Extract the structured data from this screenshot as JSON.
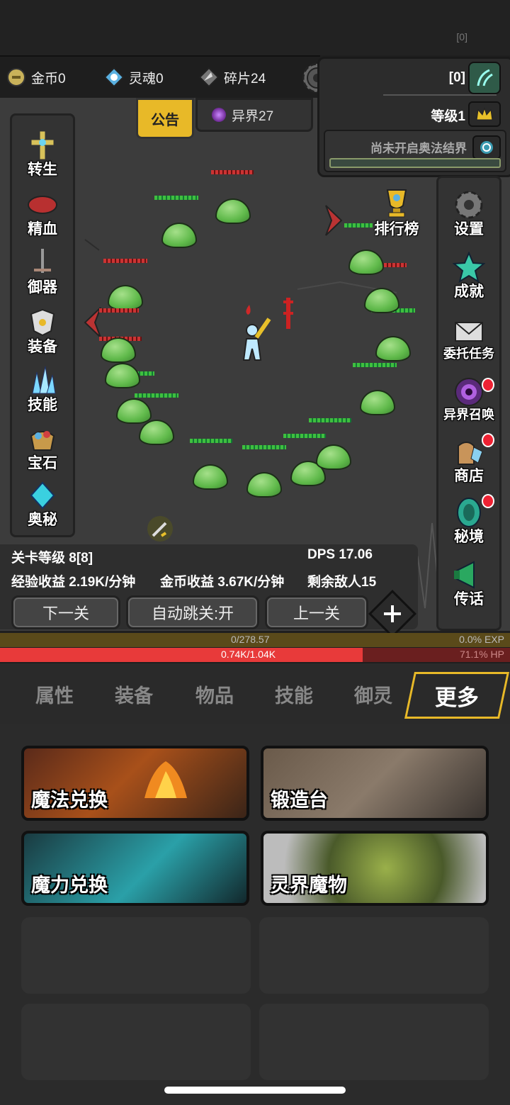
{
  "status": {
    "corner": "[0]"
  },
  "currency": {
    "gold": "金币0",
    "soul": "灵魂0",
    "shard": "碎片24"
  },
  "tabs_top": {
    "notice": "公告",
    "otherworld": "异界27"
  },
  "player_panel": {
    "bracket": "[0]",
    "level": "等级1",
    "barrier": "尚未开启奥法结界"
  },
  "left_menu": [
    {
      "label": "转生",
      "icon": "cross-icon"
    },
    {
      "label": "精血",
      "icon": "blood-gem-icon"
    },
    {
      "label": "御器",
      "icon": "sword-icon"
    },
    {
      "label": "装备",
      "icon": "armor-icon"
    },
    {
      "label": "技能",
      "icon": "ice-crystal-icon"
    },
    {
      "label": "宝石",
      "icon": "gem-bag-icon"
    },
    {
      "label": "奥秘",
      "icon": "arcane-crystal-icon"
    }
  ],
  "right_menu": [
    {
      "label": "设置",
      "icon": "gear-icon"
    },
    {
      "label": "成就",
      "icon": "star-icon"
    },
    {
      "label": "委托任务",
      "icon": "letter-icon"
    },
    {
      "label": "异界召唤",
      "icon": "portal-icon"
    },
    {
      "label": "商店",
      "icon": "shop-bag-icon"
    },
    {
      "label": "秘境",
      "icon": "secret-realm-icon"
    },
    {
      "label": "传话",
      "icon": "megaphone-icon"
    }
  ],
  "leaderboard": "排行榜",
  "stage": {
    "level": "关卡等级 8[8]",
    "dps": "DPS 17.06",
    "exp_rate": "经验收益 2.19K/分钟",
    "gold_rate": "金币收益 3.67K/分钟",
    "enemies": "剩余敌人15"
  },
  "controls": {
    "next": "下一关",
    "auto": "自动跳关:开",
    "prev": "上一关"
  },
  "bars": {
    "exp_value": "0/278.57",
    "exp_pct": "0.0% EXP",
    "exp_fraction": 0.0,
    "hp_value": "0.74K/1.04K",
    "hp_pct": "71.1% HP",
    "hp_fraction": 0.711
  },
  "bottom_tabs": [
    "属性",
    "装备",
    "物品",
    "技能",
    "御灵",
    "更多"
  ],
  "cards": [
    "魔法兑换",
    "锻造台",
    "魔力兑换",
    "灵界魔物"
  ],
  "colors": {
    "accent": "#e8b928",
    "hp": "#e83a3a",
    "exp": "#8a7a2a"
  }
}
